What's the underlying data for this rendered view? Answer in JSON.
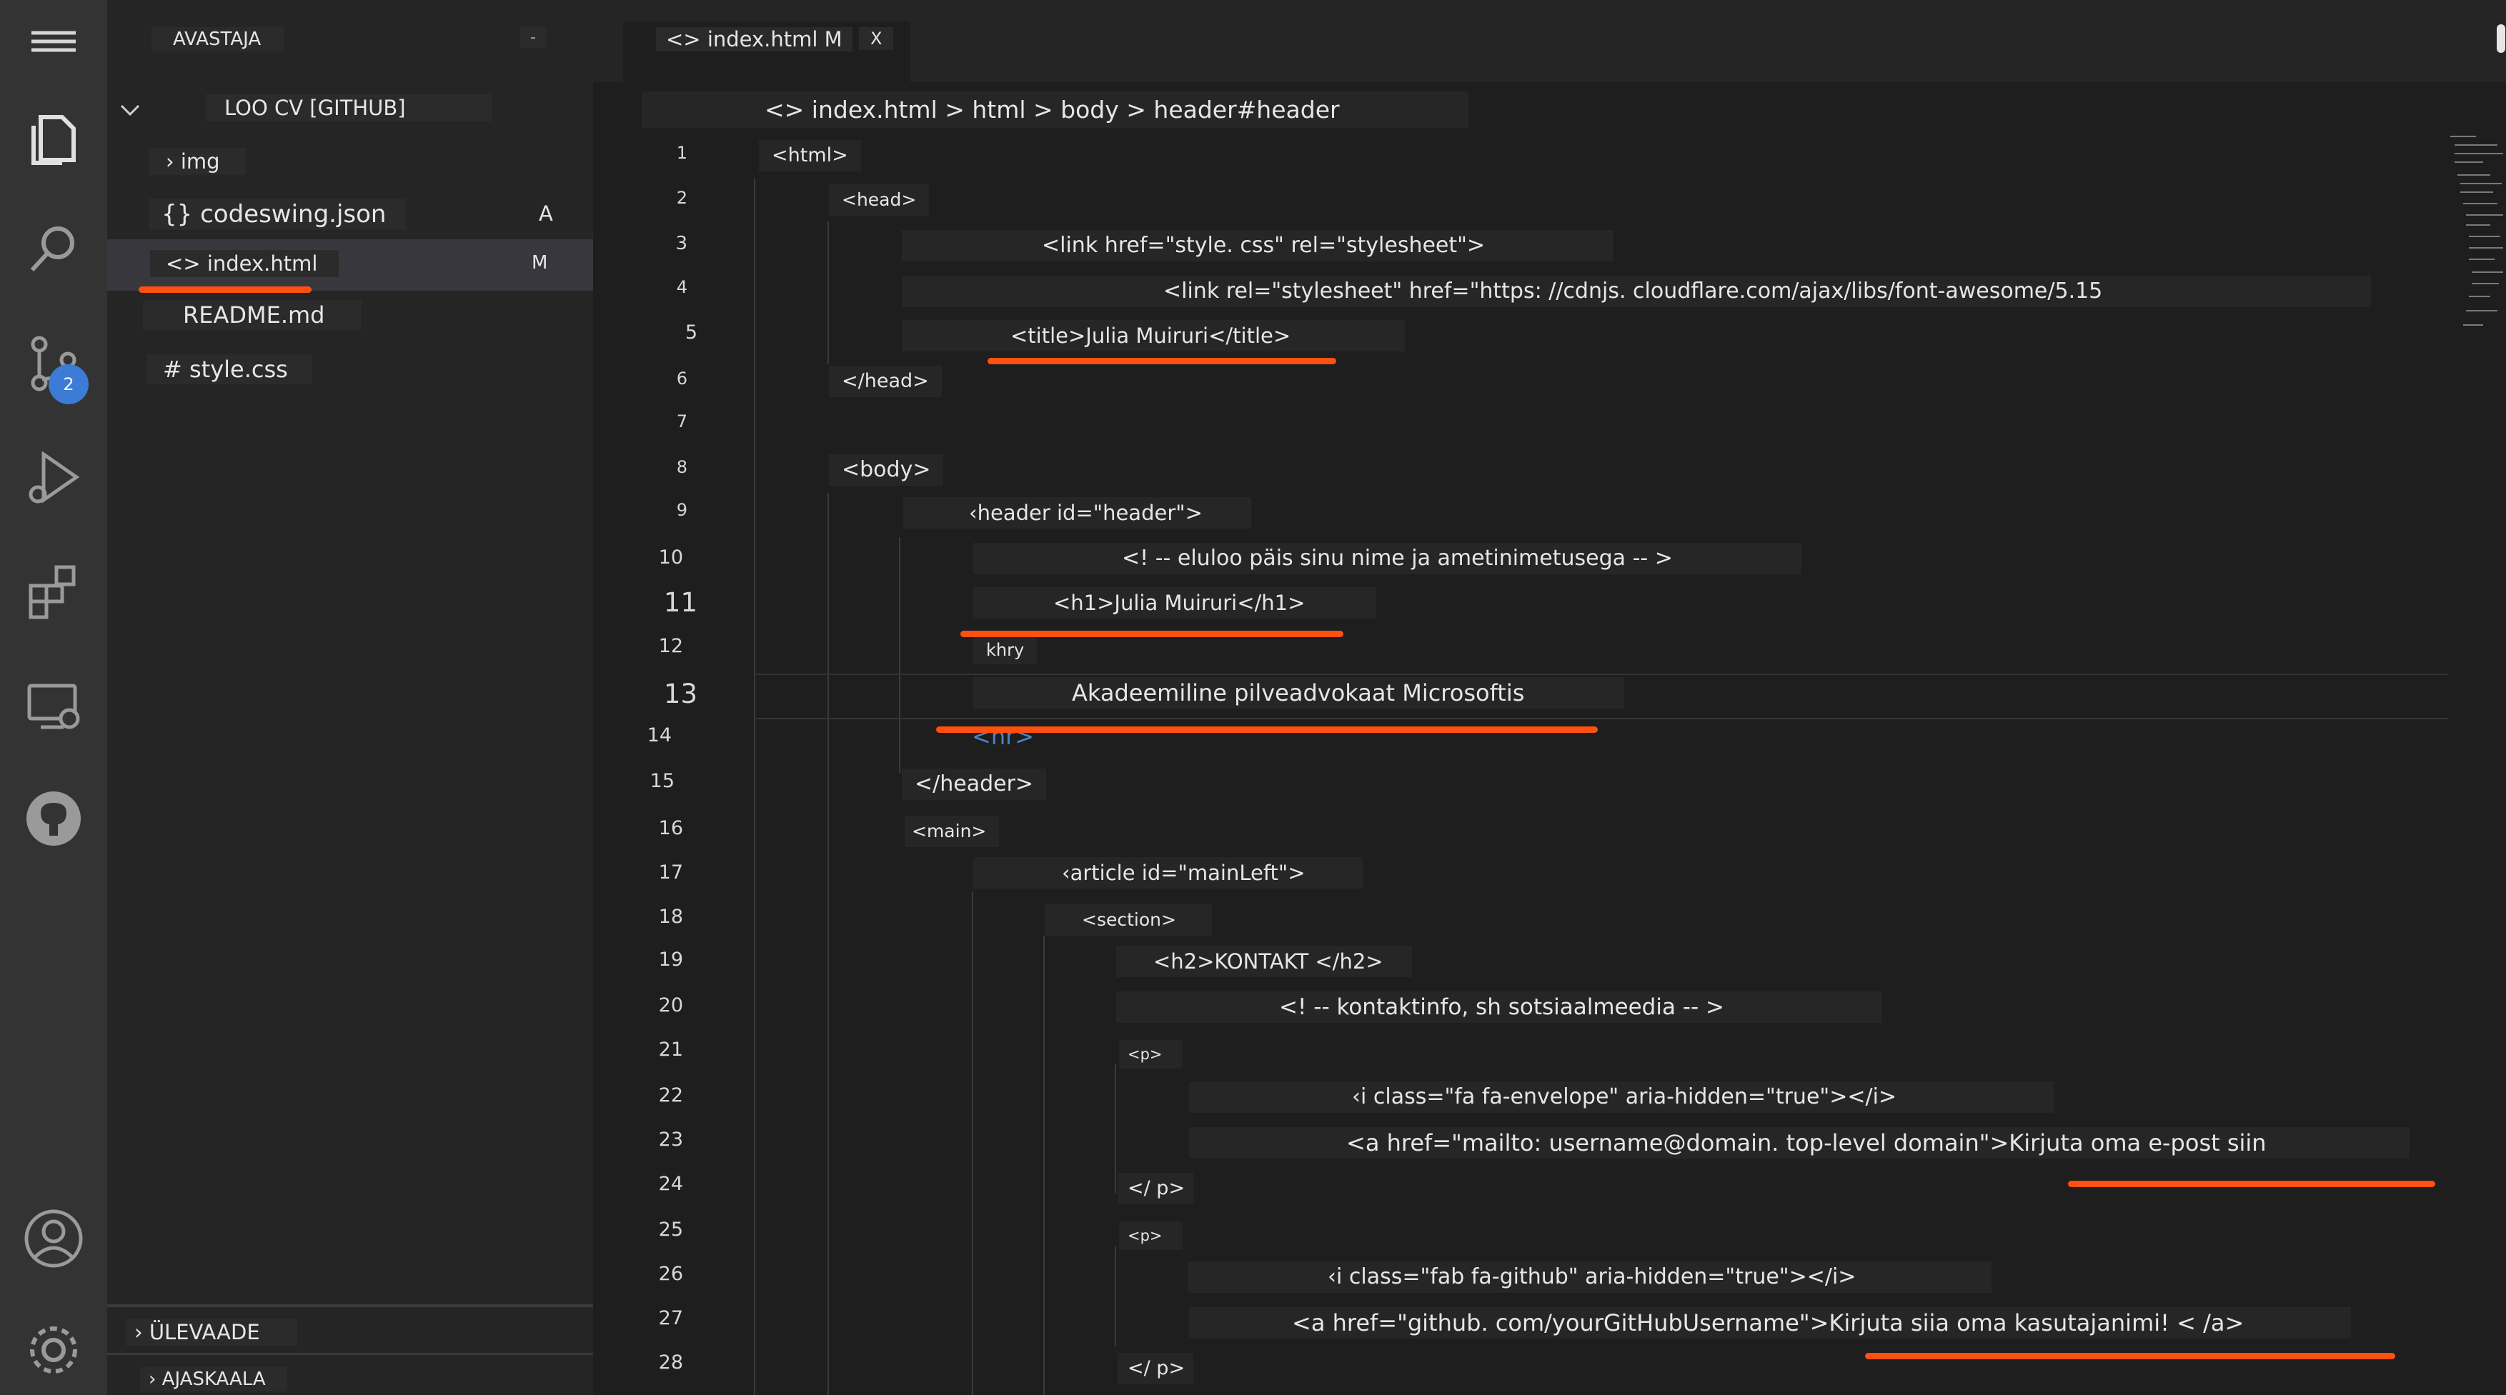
{
  "sidebar": {
    "title": "AVASTAJA",
    "collapse_glyph": "-",
    "project": "LOO CV [GITHUB]",
    "items": [
      {
        "label": "› img",
        "badge": ""
      },
      {
        "label": "{} codeswing.json",
        "badge": "A"
      },
      {
        "label": "<> index.html",
        "badge": "M"
      },
      {
        "label": "README.md",
        "badge": ""
      },
      {
        "label": "# style.css",
        "badge": ""
      }
    ],
    "outline": "› ÜLEVAADE",
    "timeline": "› AJASKAALA"
  },
  "activity": {
    "icons": [
      "menu-icon",
      "explorer-icon",
      "search-icon",
      "source-control-icon",
      "run-debug-icon",
      "extensions-icon",
      "remote-explorer-icon",
      "github-icon",
      "account-icon",
      "settings-gear-icon"
    ],
    "scm_badge": "2"
  },
  "tab": {
    "label": "<> index.html M",
    "close": "X"
  },
  "breadcrumb": "<> index.html > html > body > header#header",
  "code": [
    {
      "n": "1",
      "text": "<html>"
    },
    {
      "n": "2",
      "text": "<head>"
    },
    {
      "n": "3",
      "text": "<link href=\"style. css\" rel=\"stylesheet\">"
    },
    {
      "n": "4",
      "text": "<link rel=\"stylesheet\" href=\"https: //cdnjs. cloudflare.com/ajax/libs/font-awesome/5.15"
    },
    {
      "n": "5",
      "text": "<title>Julia Muiruri</title>"
    },
    {
      "n": "6",
      "text": "</head>"
    },
    {
      "n": "7",
      "text": ""
    },
    {
      "n": "8",
      "text": "<body>"
    },
    {
      "n": "9",
      "text": "‹header id=\"header\">"
    },
    {
      "n": "10",
      "text": "<! -- eluloo päis sinu nime ja ametinimetusega -- >"
    },
    {
      "n": "11",
      "text": "<h1>Julia Muiruri</h1>"
    },
    {
      "n": "12",
      "text": "khry"
    },
    {
      "n": "13",
      "text": "Akadeemiline pilveadvokaat Microsoftis"
    },
    {
      "n": "14",
      "text": "<hr>"
    },
    {
      "n": "15",
      "text": "</header>"
    },
    {
      "n": "16",
      "text": "<main>"
    },
    {
      "n": "17",
      "text": "‹article id=\"mainLeft\">"
    },
    {
      "n": "18",
      "text": "<section>"
    },
    {
      "n": "19",
      "text": "<h2>KONTAKT </h2>"
    },
    {
      "n": "20",
      "text": "<! -- kontaktinfo, sh sotsiaalmeedia -- >"
    },
    {
      "n": "21",
      "text": "<p>"
    },
    {
      "n": "22",
      "text": "‹i class=\"fa fa-envelope\" aria-hidden=\"true\"></i>"
    },
    {
      "n": "23",
      "text": "<a href=\"mailto: username@domain. top-level domain\">Kirjuta oma e-post siin"
    },
    {
      "n": "24",
      "text": "</ p>"
    },
    {
      "n": "25",
      "text": "<p>"
    },
    {
      "n": "26",
      "text": "‹i class=\"fab fa-github\" aria-hidden=\"true\"></i>"
    },
    {
      "n": "27",
      "text": "<a href=\"github. com/yourGitHubUsername\">Kirjuta siia oma kasutajanimi! < /a>"
    },
    {
      "n": "28",
      "text": "</ p>"
    }
  ],
  "colors": {
    "annotation": "#ff4f11",
    "hr_tag": "#4a86c8",
    "badge": "#3c7bd6"
  }
}
